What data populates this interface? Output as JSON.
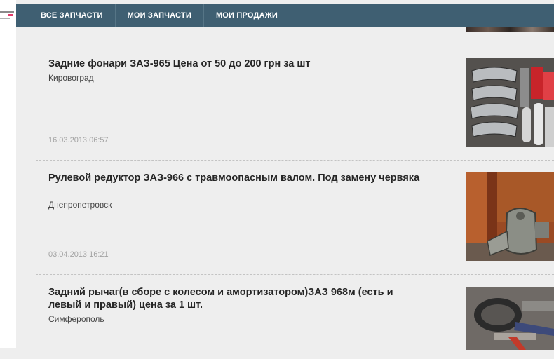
{
  "nav": {
    "items": [
      {
        "label": "ВСЕ ЗАПЧАСТИ"
      },
      {
        "label": "МОИ ЗАПЧАСТИ"
      },
      {
        "label": "МОИ ПРОДАЖИ"
      }
    ]
  },
  "listings": [
    {
      "title": "Задние фонари ЗАЗ-965 Цена от 50 до 200 грн за шт",
      "city": "Кировоград",
      "date": "16.03.2013 06:57",
      "thumb_icon": "tail-lights-photo"
    },
    {
      "title": "Рулевой редуктор ЗАЗ-966 с травмоопасным валом. Под замену червяка",
      "city": "Днепропетровск",
      "date": "03.04.2013 16:21",
      "thumb_icon": "steering-gearbox-photo"
    },
    {
      "title": "Задний рычаг(в сборе с колесом и амортизатором)ЗАЗ 968м (есть и левый и правый) цена за 1 шт.",
      "city": "Симферополь",
      "date": "",
      "thumb_icon": "rear-arm-wheel-photo"
    }
  ],
  "colors": {
    "navbar": "#3f5f72",
    "page_bg": "#eeeeee",
    "logo_accent": "#e23a6a"
  }
}
